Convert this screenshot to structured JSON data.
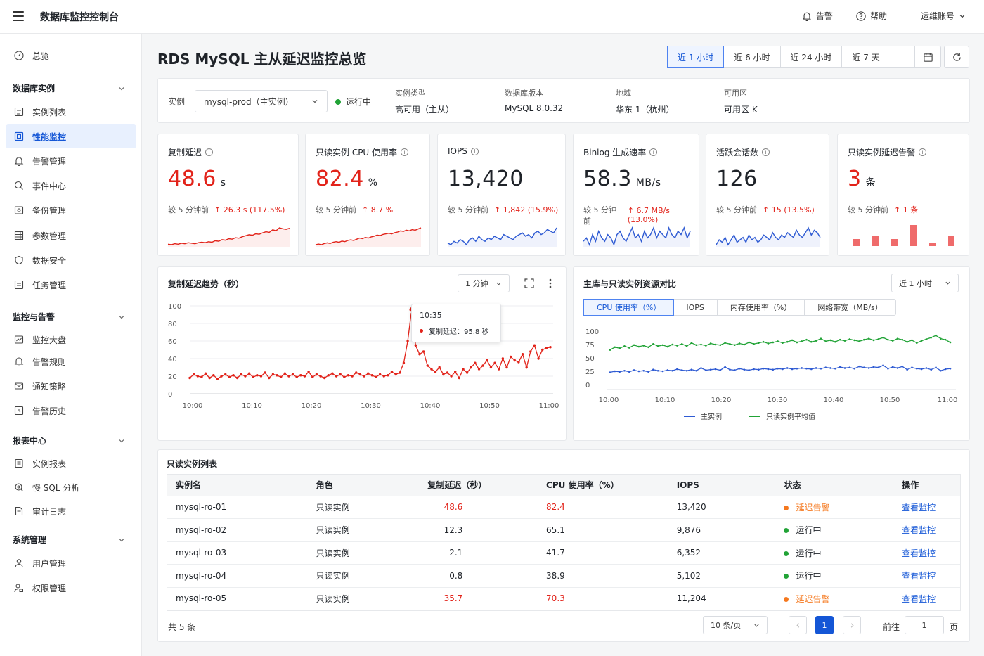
{
  "app": {
    "title": "数据库监控控制台"
  },
  "topbar": {
    "alert": "告警",
    "help": "帮助",
    "account": "运维账号"
  },
  "sidebar": {
    "overview": "总览",
    "groups": [
      {
        "label": "数据库实例",
        "items": [
          "实例列表",
          "性能监控",
          "告警管理",
          "事件中心",
          "备份管理",
          "参数管理",
          "数据安全",
          "任务管理"
        ]
      },
      {
        "label": "监控与告警",
        "items": [
          "监控大盘",
          "告警规则",
          "通知策略",
          "告警历史"
        ]
      },
      {
        "label": "报表中心",
        "items": [
          "实例报表",
          "慢 SQL 分析",
          "审计日志"
        ]
      },
      {
        "label": "系统管理",
        "items": [
          "用户管理",
          "权限管理"
        ]
      }
    ],
    "active_item": "性能监控"
  },
  "page": {
    "title": "RDS MySQL 主从延迟监控总览"
  },
  "time_range": {
    "options": [
      "近 1 小时",
      "近 6 小时",
      "近 24 小时",
      "近 7 天"
    ],
    "active": "近 1 小时"
  },
  "instance_info": {
    "instance_label": "实例",
    "instance_value": "mysql-prod（主实例）",
    "status": "运行中",
    "fields": [
      {
        "label": "实例类型",
        "value": "高可用（主从）"
      },
      {
        "label": "数据库版本",
        "value": "MySQL 8.0.32"
      },
      {
        "label": "地域",
        "value": "华东 1（杭州）"
      },
      {
        "label": "可用区",
        "value": "可用区 K"
      }
    ]
  },
  "kpis": [
    {
      "title": "复制延迟",
      "value": "48.6",
      "unit": "s",
      "compare_label": "较 5 分钟前",
      "change": "26.3 s (117.5%)",
      "value_color": "#e2231a",
      "spark_color": "#e2231a",
      "spark_type": "line"
    },
    {
      "title": "只读实例 CPU 使用率",
      "value": "82.4",
      "unit": "%",
      "compare_label": "较 5 分钟前",
      "change": "8.7 %",
      "value_color": "#e2231a",
      "spark_color": "#e2231a",
      "spark_type": "line"
    },
    {
      "title": "IOPS",
      "value": "13,420",
      "unit": "",
      "compare_label": "较 5 分钟前",
      "change": "1,842 (15.9%)",
      "value_color": "#1f2329",
      "spark_color": "#2f5bd3",
      "spark_type": "line"
    },
    {
      "title": "Binlog 生成速率",
      "value": "58.3",
      "unit": "MB/s",
      "compare_label": "较 5 分钟前",
      "change": "6.7 MB/s (13.0%)",
      "value_color": "#1f2329",
      "spark_color": "#2f5bd3",
      "spark_type": "line"
    },
    {
      "title": "活跃会话数",
      "value": "126",
      "unit": "",
      "compare_label": "较 5 分钟前",
      "change": "15 (13.5%)",
      "value_color": "#1f2329",
      "spark_color": "#2f5bd3",
      "spark_type": "line"
    },
    {
      "title": "只读实例延迟告警",
      "value": "3",
      "unit": "条",
      "compare_label": "较 5 分钟前",
      "change": "1 条",
      "value_color": "#e2231a",
      "spark_color": "#ef6b6b",
      "spark_type": "bar"
    }
  ],
  "delay_chart": {
    "title": "复制延迟趋势（秒）",
    "interval": "1 分钟",
    "tooltip_time": "10:35",
    "tooltip_label": "复制延迟：95.8 秒",
    "chart_data": {
      "type": "line",
      "title": "复制延迟趋势（秒）",
      "x_ticks": [
        "10:00",
        "10:10",
        "10:20",
        "10:30",
        "10:40",
        "10:50",
        "11:00"
      ],
      "y_ticks": [
        "100",
        "80",
        "60",
        "40",
        "20",
        "0"
      ],
      "ylim": [
        0,
        100
      ],
      "grid": true,
      "series": [
        {
          "color": "#e2231a",
          "values": [
            18,
            22,
            20,
            19,
            23,
            18,
            21,
            17,
            20,
            22,
            19,
            21,
            18,
            22,
            20,
            23,
            19,
            21,
            20,
            24,
            18,
            22,
            21,
            19,
            23,
            20,
            22,
            19,
            21,
            20,
            25,
            19,
            22,
            20,
            18,
            21,
            23,
            20,
            22,
            19,
            21,
            20,
            24,
            22,
            20,
            23,
            21,
            19,
            22,
            20,
            21,
            25,
            22,
            24,
            35,
            60,
            95.8,
            55,
            45,
            48,
            32,
            28,
            25,
            30,
            22,
            24,
            20,
            25,
            18,
            28,
            24,
            30,
            35,
            28,
            32,
            38,
            30,
            35,
            28,
            40,
            30,
            42,
            38,
            36,
            45,
            30,
            48,
            55,
            40,
            50,
            52,
            53
          ]
        }
      ]
    }
  },
  "resource_chart": {
    "title": "主库与只读实例资源对比",
    "range": "近 1 小时",
    "tabs": [
      "CPU 使用率（%）",
      "IOPS",
      "内存使用率（%）",
      "网络带宽（MB/s）"
    ],
    "active_tab": "CPU 使用率（%）",
    "chart_data": {
      "type": "line",
      "title": "主库与只读实例资源对比",
      "x_ticks": [
        "10:00",
        "10:10",
        "10:20",
        "10:30",
        "10:40",
        "10:50",
        "11:00"
      ],
      "y_ticks": [
        "100",
        "75",
        "50",
        "25",
        "0"
      ],
      "ylim": [
        0,
        100
      ],
      "grid": false,
      "legend": "bottom",
      "series": [
        {
          "name": "主实例",
          "color": "#2f5bd3",
          "values": [
            23,
            25,
            24,
            26,
            24,
            27,
            25,
            26,
            24,
            28,
            26,
            25,
            27,
            26,
            29,
            27,
            26,
            28,
            26,
            31,
            27,
            28,
            29,
            27,
            33,
            28,
            27,
            30,
            28,
            27,
            29,
            28,
            30,
            29,
            28,
            30,
            29,
            31,
            29,
            30,
            31,
            30,
            29,
            31,
            30,
            32,
            31,
            30,
            33,
            31,
            32,
            30,
            34,
            32,
            31,
            33,
            32,
            36,
            30,
            33,
            31,
            34,
            28,
            32,
            30,
            29,
            31,
            28,
            32,
            26,
            29,
            30
          ]
        },
        {
          "name": "只读实例平均值",
          "color": "#21a336",
          "values": [
            65,
            70,
            68,
            72,
            69,
            74,
            71,
            73,
            70,
            76,
            72,
            74,
            71,
            75,
            73,
            76,
            72,
            78,
            74,
            75,
            73,
            77,
            75,
            74,
            78,
            76,
            74,
            77,
            75,
            79,
            76,
            78,
            80,
            77,
            79,
            81,
            78,
            80,
            83,
            79,
            81,
            84,
            80,
            82,
            86,
            81,
            83,
            80,
            84,
            82,
            85,
            83,
            81,
            84,
            86,
            83,
            85,
            88,
            84,
            82,
            86,
            84,
            80,
            83,
            78,
            82,
            85,
            88,
            92,
            86,
            84,
            79
          ]
        }
      ]
    }
  },
  "replica_table": {
    "title": "只读实例列表",
    "columns": [
      "实例名",
      "角色",
      "复制延迟（秒）",
      "CPU 使用率（%）",
      "IOPS",
      "状态",
      "操作"
    ],
    "rows": [
      {
        "name": "mysql-ro-01",
        "role": "只读实例",
        "delay": "48.6",
        "cpu": "82.4",
        "iops": "13,420",
        "status": "延迟告警",
        "action": "查看监控",
        "alert": true
      },
      {
        "name": "mysql-ro-02",
        "role": "只读实例",
        "delay": "12.3",
        "cpu": "65.1",
        "iops": "9,876",
        "status": "运行中",
        "action": "查看监控",
        "alert": false
      },
      {
        "name": "mysql-ro-03",
        "role": "只读实例",
        "delay": "2.1",
        "cpu": "41.7",
        "iops": "6,352",
        "status": "运行中",
        "action": "查看监控",
        "alert": false
      },
      {
        "name": "mysql-ro-04",
        "role": "只读实例",
        "delay": "0.8",
        "cpu": "38.9",
        "iops": "5,102",
        "status": "运行中",
        "action": "查看监控",
        "alert": false
      },
      {
        "name": "mysql-ro-05",
        "role": "只读实例",
        "delay": "35.7",
        "cpu": "70.3",
        "iops": "11,204",
        "status": "延迟告警",
        "action": "查看监控",
        "alert": true
      }
    ],
    "total": "共 5 条",
    "page_size": "10 条/页",
    "current_page": "1",
    "goto_label": "前往",
    "goto_value": "1",
    "page_suffix": "页"
  },
  "colors": {
    "primary": "#1456d6",
    "danger": "#e2231a",
    "warning": "#f5781e",
    "success": "#21a336"
  }
}
